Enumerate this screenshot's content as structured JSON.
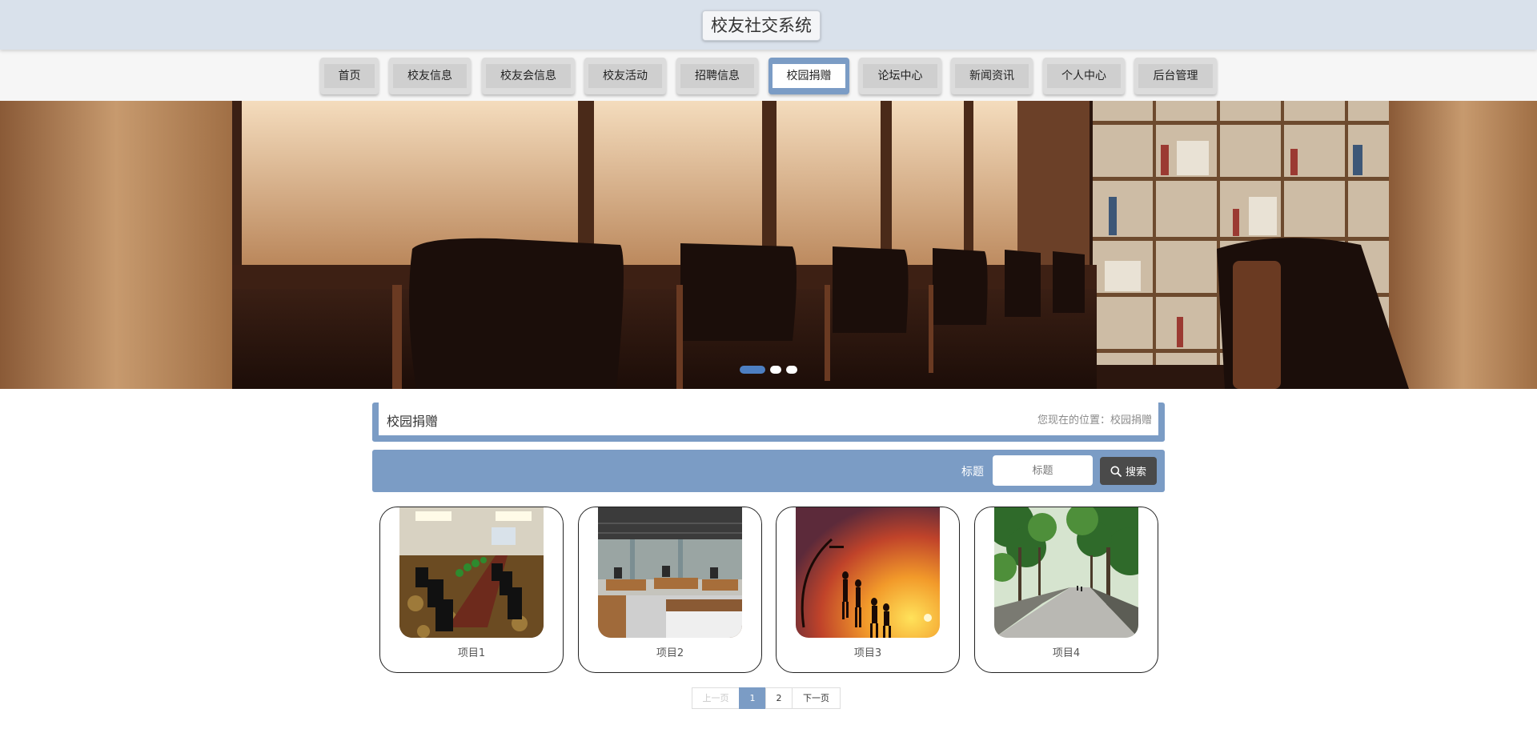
{
  "header": {
    "title": "校友社交系统"
  },
  "nav": {
    "items": [
      {
        "label": "首页"
      },
      {
        "label": "校友信息"
      },
      {
        "label": "校友会信息"
      },
      {
        "label": "校友活动"
      },
      {
        "label": "招聘信息"
      },
      {
        "label": "校园捐赠",
        "active": true
      },
      {
        "label": "论坛中心"
      },
      {
        "label": "新闻资讯"
      },
      {
        "label": "个人中心"
      },
      {
        "label": "后台管理"
      }
    ]
  },
  "banner": {
    "slides": 3,
    "active_slide": 1
  },
  "section": {
    "title": "校园捐赠",
    "breadcrumb": "您现在的位置：校园捐赠"
  },
  "search": {
    "label": "标题",
    "placeholder": "标题",
    "button_label": "搜索"
  },
  "items": [
    {
      "label": "项目1",
      "image": "conference-room"
    },
    {
      "label": "项目2",
      "image": "open-office"
    },
    {
      "label": "项目3",
      "image": "basketball-sunset"
    },
    {
      "label": "项目4",
      "image": "tree-lined-road"
    }
  ],
  "pagination": {
    "prev": "上一页",
    "pages": [
      "1",
      "2"
    ],
    "current": "1",
    "next": "下一页"
  },
  "colors": {
    "accent": "#7b9cc5",
    "header_bg": "#d9e1eb",
    "search_button": "#4a4a4a"
  }
}
